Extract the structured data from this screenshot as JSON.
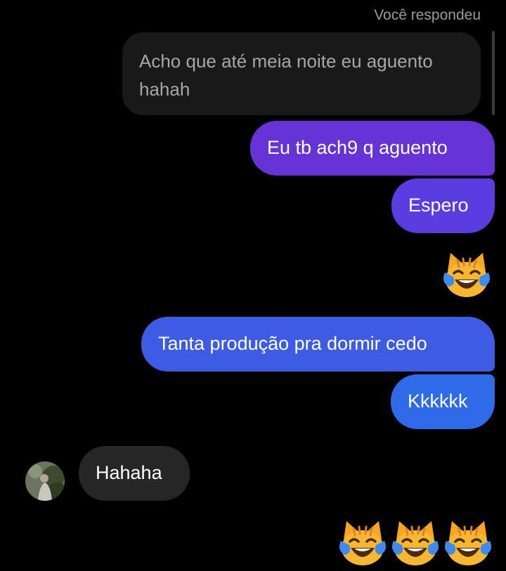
{
  "conversation": {
    "reply_label": "Você respondeu",
    "replied_message": "Acho que até meia noite eu aguento hahah",
    "sent_messages": [
      "Eu tb ach9 q aguento",
      "Espero",
      "Tanta produção pra dormir cedo",
      "Kkkkkk"
    ],
    "received_message": "Hahaha"
  },
  "reactions": {
    "single_emoji": "cat-face-with-tears-of-joy",
    "triple_emoji": [
      "cat-face-with-tears-of-joy",
      "cat-face-with-tears-of-joy",
      "cat-face-with-tears-of-joy"
    ]
  },
  "colors": {
    "background": "#000000",
    "replied_bubble": "#191919",
    "received_bubble": "#262626",
    "sent_gradient_top": "#6634d6",
    "sent_gradient_bottom": "#2f6ae9"
  }
}
